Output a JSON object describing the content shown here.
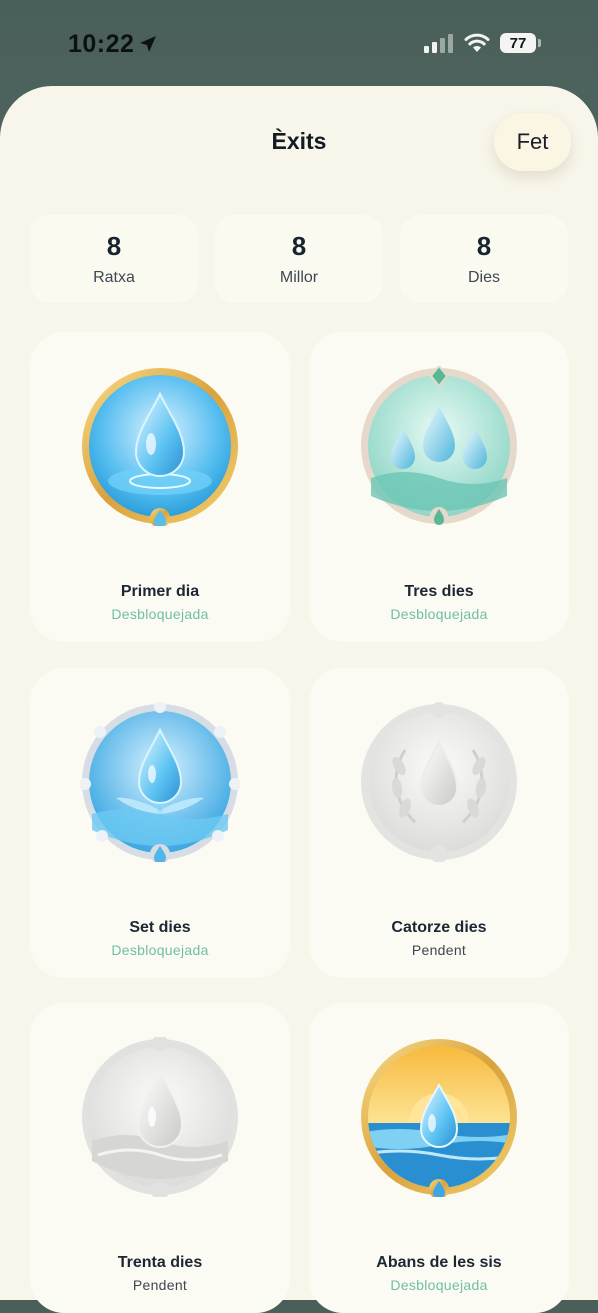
{
  "status_bar": {
    "time": "10:22",
    "battery": "77"
  },
  "header": {
    "title": "Èxits",
    "done_label": "Fet"
  },
  "stats": [
    {
      "value": "8",
      "label": "Ratxa"
    },
    {
      "value": "8",
      "label": "Millor"
    },
    {
      "value": "8",
      "label": "Dies"
    }
  ],
  "achievements": [
    {
      "name": "Primer dia",
      "status": "Desbloquejada"
    },
    {
      "name": "Tres dies",
      "status": "Desbloquejada"
    },
    {
      "name": "Set dies",
      "status": "Desbloquejada"
    },
    {
      "name": "Catorze dies",
      "status": "Pendent"
    },
    {
      "name": "Trenta dies",
      "status": "Pendent"
    },
    {
      "name": "Abans de les sis",
      "status": "Desbloquejada"
    }
  ],
  "colors": {
    "unlocked": "#6fbea6",
    "pending": "#3e4650",
    "background": "#f8f6ea"
  }
}
